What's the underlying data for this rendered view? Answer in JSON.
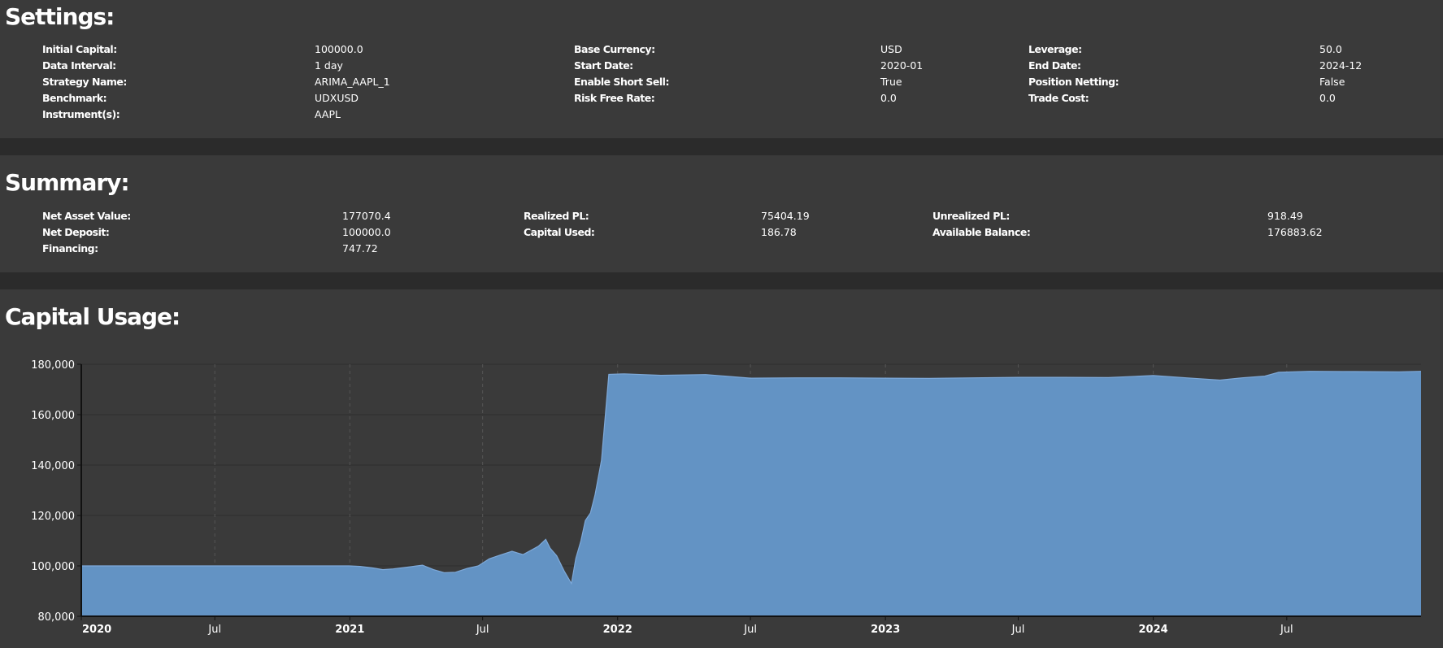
{
  "settings": {
    "title": "Settings:",
    "items": [
      {
        "label": "Initial Capital:",
        "value": "100000.0"
      },
      {
        "label": "Data Interval:",
        "value": "1 day"
      },
      {
        "label": "Strategy Name:",
        "value": "ARIMA_AAPL_1"
      },
      {
        "label": "Benchmark:",
        "value": "UDXUSD"
      },
      {
        "label": "Instrument(s):",
        "value": "AAPL"
      },
      {
        "label": "Base Currency:",
        "value": "USD"
      },
      {
        "label": "Start Date:",
        "value": "2020-01"
      },
      {
        "label": "Enable Short Sell:",
        "value": "True"
      },
      {
        "label": "Risk Free Rate:",
        "value": "0.0"
      },
      {
        "label": "Leverage:",
        "value": "50.0"
      },
      {
        "label": "End Date:",
        "value": "2024-12"
      },
      {
        "label": "Position Netting:",
        "value": "False"
      },
      {
        "label": "Trade Cost:",
        "value": "0.0"
      }
    ]
  },
  "summary": {
    "title": "Summary:",
    "items": [
      {
        "label": "Net Asset Value:",
        "value": "177070.4"
      },
      {
        "label": "Net Deposit:",
        "value": "100000.0"
      },
      {
        "label": "Financing:",
        "value": "747.72"
      },
      {
        "label": "Realized PL:",
        "value": "75404.19"
      },
      {
        "label": "Capital Used:",
        "value": "186.78"
      },
      {
        "label": "Unrealized PL:",
        "value": "918.49"
      },
      {
        "label": "Available Balance:",
        "value": "176883.62"
      }
    ]
  },
  "capital_usage": {
    "title": "Capital Usage:"
  },
  "chart_data": {
    "type": "area",
    "title": "",
    "xlabel": "",
    "ylabel": "",
    "ylim": [
      80000,
      180000
    ],
    "xlim": [
      "2020-01-01",
      "2024-12-31"
    ],
    "y_ticks": [
      80000,
      100000,
      120000,
      140000,
      160000,
      180000
    ],
    "y_tick_labels": [
      "80,000",
      "100,000",
      "120,000",
      "140,000",
      "160,000",
      "180,000"
    ],
    "x_ticks": [
      {
        "date": "2020-01-01",
        "label": "2020",
        "major": true
      },
      {
        "date": "2020-07-01",
        "label": "Jul",
        "major": false
      },
      {
        "date": "2021-01-01",
        "label": "2021",
        "major": true
      },
      {
        "date": "2021-07-01",
        "label": "Jul",
        "major": false
      },
      {
        "date": "2022-01-01",
        "label": "2022",
        "major": true
      },
      {
        "date": "2022-07-01",
        "label": "Jul",
        "major": false
      },
      {
        "date": "2023-01-01",
        "label": "2023",
        "major": true
      },
      {
        "date": "2023-07-01",
        "label": "Jul",
        "major": false
      },
      {
        "date": "2024-01-01",
        "label": "2024",
        "major": true
      },
      {
        "date": "2024-07-01",
        "label": "Jul",
        "major": false
      }
    ],
    "grid": true,
    "area_color": "#6393c4",
    "line_color": "#7ea9d9",
    "series": [
      {
        "x": [
          "2020-01-01",
          "2020-06-01",
          "2020-12-31",
          "2021-01-15",
          "2021-02-01",
          "2021-02-15",
          "2021-03-01",
          "2021-03-20",
          "2021-04-10",
          "2021-04-25",
          "2021-05-10",
          "2021-05-25",
          "2021-06-10",
          "2021-06-25",
          "2021-07-10",
          "2021-07-25",
          "2021-08-10",
          "2021-08-25",
          "2021-09-05",
          "2021-09-15",
          "2021-09-25",
          "2021-10-01",
          "2021-10-10",
          "2021-10-20",
          "2021-10-30",
          "2021-11-05",
          "2021-11-12",
          "2021-11-18",
          "2021-11-25",
          "2021-12-01",
          "2021-12-10",
          "2021-12-20",
          "2022-01-10",
          "2022-03-01",
          "2022-05-01",
          "2022-07-01",
          "2022-09-01",
          "2022-11-01",
          "2023-01-01",
          "2023-03-01",
          "2023-05-01",
          "2023-07-01",
          "2023-09-01",
          "2023-11-01",
          "2024-01-01",
          "2024-02-15",
          "2024-04-01",
          "2024-05-01",
          "2024-06-01",
          "2024-06-20",
          "2024-08-01",
          "2024-10-01",
          "2024-12-01",
          "2024-12-31"
        ],
        "y": [
          100000,
          100000,
          100000,
          99800,
          99200,
          98500,
          98800,
          99500,
          100300,
          98500,
          97300,
          97500,
          99000,
          100000,
          102800,
          104300,
          105800,
          104500,
          106200,
          107800,
          110500,
          107000,
          104000,
          98000,
          93000,
          103000,
          110000,
          118000,
          121000,
          128000,
          142000,
          176000,
          176200,
          175600,
          175900,
          174500,
          174600,
          174600,
          174500,
          174400,
          174600,
          174800,
          174800,
          174700,
          175500,
          174600,
          173700,
          174600,
          175300,
          176800,
          177200,
          177100,
          177000,
          177200
        ]
      }
    ]
  }
}
